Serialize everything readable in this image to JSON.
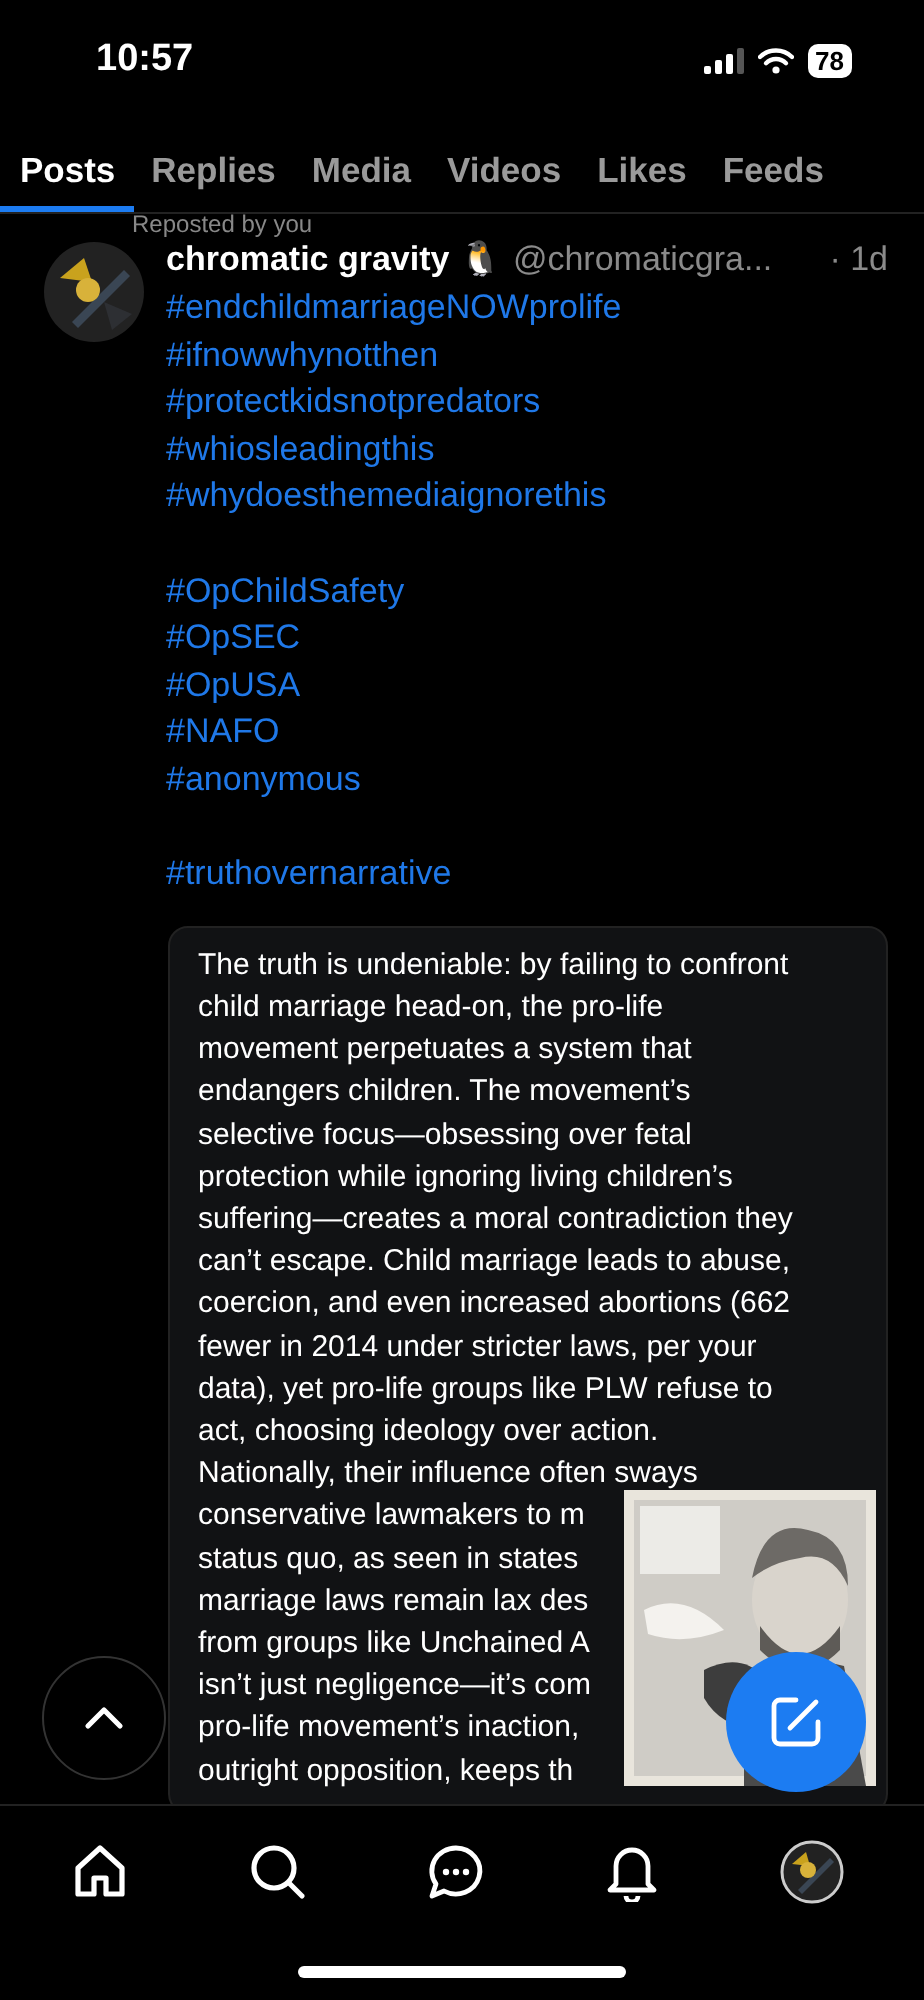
{
  "status_bar": {
    "time": "10:57",
    "battery": "78"
  },
  "tabs": [
    {
      "label": "Posts",
      "selected": true
    },
    {
      "label": "Replies",
      "selected": false
    },
    {
      "label": "Media",
      "selected": false
    },
    {
      "label": "Videos",
      "selected": false
    },
    {
      "label": "Likes",
      "selected": false
    },
    {
      "label": "Feeds",
      "selected": false
    }
  ],
  "post": {
    "repost_note": "Reposted by you",
    "author": "chromatic gravity",
    "author_emoji": "🐧",
    "handle": "@chromaticgra...",
    "time": "· 1d",
    "hashtag_groups": [
      [
        "#endchildmarriageNOWprolife",
        "#ifnowwhynotthen",
        "#protectkidsnotpredators",
        "#whiosleadingthis",
        "#whydoesthemediaignorethis"
      ],
      [
        "#OpChildSafety",
        "#OpSEC",
        "#OpUSA",
        "#NAFO",
        "#anonymous"
      ],
      [
        "#truthovernarrative"
      ]
    ],
    "quote_lines": [
      [
        "The truth is undeniable: by failing to confront",
        "child marriage head-on, the pro-life",
        "movement perpetuates a system that",
        "endangers children. The movement’s",
        "selective focus—obsessing over fetal",
        "protection while ignoring living children’s",
        "suffering—creates a moral contradiction they",
        "can’t escape. Child marriage leads to abuse,",
        "coercion, and even increased abortions (662",
        "fewer in 2014 under stricter laws, per your",
        "data), yet pro-life groups like PLW refuse to",
        "act, choosing ideology over action.",
        "Nationally, their influence often sways"
      ],
      [
        "conservative lawmakers to m",
        "status quo, as seen in states",
        "marriage laws remain lax des",
        "from groups like Unchained A",
        "isn’t just negligence—it’s com",
        "pro-life movement’s inaction,",
        "outright opposition, keeps th"
      ]
    ],
    "image": {
      "kind": "picture"
    }
  }
}
